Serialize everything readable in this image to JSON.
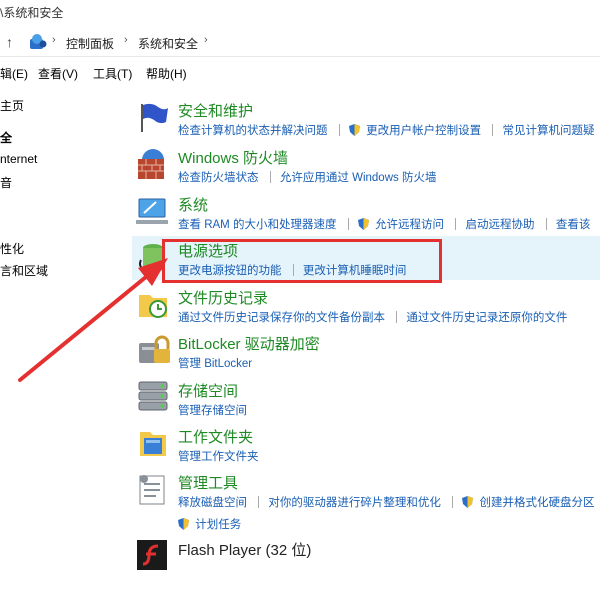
{
  "window": {
    "title": "\\系统和安全"
  },
  "address": {
    "crumbs": [
      "控制面板",
      "系统和安全"
    ]
  },
  "menu": {
    "items": [
      "编辑(E)",
      "查看(V)",
      "工具(T)",
      "帮助(H)"
    ]
  },
  "leftnav": {
    "items": [
      "主页",
      "全",
      "nternet",
      "音",
      "性化",
      "言和区域"
    ]
  },
  "categories": [
    {
      "title": "安全和维护",
      "links": [
        "检查计算机的状态并解决问题",
        "更改用户帐户控制设置",
        "常见计算机问题疑"
      ]
    },
    {
      "title": "Windows 防火墙",
      "links": [
        "检查防火墙状态",
        "允许应用通过 Windows 防火墙"
      ]
    },
    {
      "title": "系统",
      "links": [
        "查看 RAM 的大小和处理器速度",
        "允许远程访问",
        "启动远程协助",
        "查看该"
      ]
    },
    {
      "title": "电源选项",
      "links": [
        "更改电源按钮的功能",
        "更改计算机睡眠时间"
      ]
    },
    {
      "title": "文件历史记录",
      "links": [
        "通过文件历史记录保存你的文件备份副本",
        "通过文件历史记录还原你的文件"
      ]
    },
    {
      "title": "BitLocker 驱动器加密",
      "links": [
        "管理 BitLocker"
      ]
    },
    {
      "title": "存储空间",
      "links": [
        "管理存储空间"
      ]
    },
    {
      "title": "工作文件夹",
      "links": [
        "管理工作文件夹"
      ]
    },
    {
      "title": "管理工具",
      "links": [
        "释放磁盘空间",
        "对你的驱动器进行碎片整理和优化",
        "创建并格式化硬盘分区",
        "计划任务"
      ]
    },
    {
      "title": "Flash Player (32 位)",
      "links": []
    }
  ],
  "colors": {
    "title_green": "#1e8a24",
    "link_blue": "#1a5fb4",
    "highlight": "#e5f3fb",
    "annotation_red": "#e53030"
  }
}
